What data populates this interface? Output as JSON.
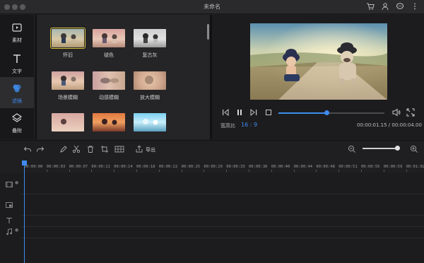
{
  "window": {
    "title": "未命名",
    "icons": [
      "cart-icon",
      "user-icon",
      "chat-icon",
      "more-icon"
    ]
  },
  "nav": {
    "items": [
      {
        "label": "素材",
        "icon": "media-icon",
        "active": false
      },
      {
        "label": "文字",
        "icon": "text-icon",
        "active": false
      },
      {
        "label": "滤镜",
        "icon": "filter-icon",
        "active": true
      },
      {
        "label": "叠附",
        "icon": "overlay-icon",
        "active": false
      }
    ]
  },
  "filters": {
    "items": [
      {
        "label": "怀旧",
        "selected": true
      },
      {
        "label": "褪色",
        "selected": false
      },
      {
        "label": "复古灰",
        "selected": false
      },
      {
        "label": "场景模糊",
        "selected": false
      },
      {
        "label": "动感模糊",
        "selected": false
      },
      {
        "label": "放大模糊",
        "selected": false
      },
      {
        "label": "",
        "selected": false
      },
      {
        "label": "",
        "selected": false
      },
      {
        "label": "",
        "selected": false
      }
    ]
  },
  "player": {
    "aspect_label": "宽高比",
    "aspect_value": "16 : 9",
    "timecode": "00:00:01.15 / 00:00:04.00",
    "progress": 0.45
  },
  "toolbar": {
    "export_label": "导出",
    "zoom": 0.95
  },
  "timeline": {
    "ticks": [
      "00:00:00",
      "00:00:03",
      "00:00:07",
      "00:00:11",
      "00:00:14",
      "00:00:18",
      "00:00:22",
      "00:00:25",
      "00:00:29",
      "00:00:33",
      "00:00:36",
      "00:00:40",
      "00:00:44",
      "00:00:48",
      "00:00:51",
      "00:00:55",
      "00:00:59",
      "00:01:02"
    ],
    "tracks": [
      "video-track-icon",
      "pip-track-icon",
      "text-track-icon",
      "music-track-icon"
    ]
  },
  "colors": {
    "accent": "#3f8cf0",
    "selected_outline": "#d9c23a"
  }
}
